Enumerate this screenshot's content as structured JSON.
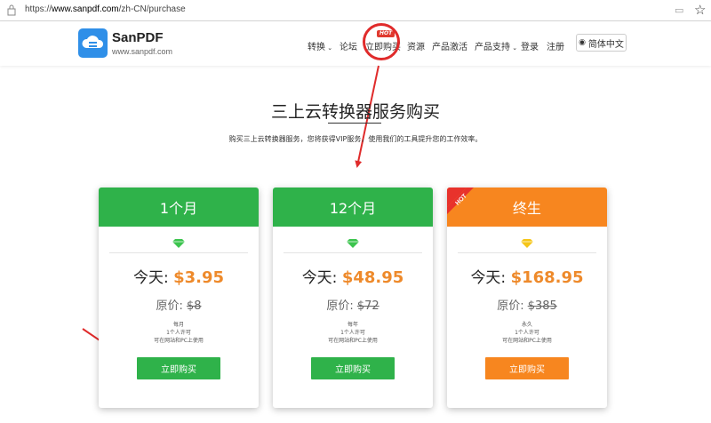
{
  "browser": {
    "url_prefix": "https://",
    "url_domain": "www.sanpdf.com",
    "url_path": "/zh-CN/purchase"
  },
  "header": {
    "logo_name": "SanPDF",
    "logo_url": "www.sanpdf.com",
    "nav": [
      {
        "label": "转换",
        "dropdown": true
      },
      {
        "label": "论坛"
      },
      {
        "label": "立即购买",
        "badge": "HOT"
      },
      {
        "label": "资源"
      },
      {
        "label": "产品激活"
      },
      {
        "label": "产品支持",
        "dropdown": true
      },
      {
        "label": "登录"
      },
      {
        "label": "注册"
      }
    ],
    "language": "简体中文"
  },
  "page": {
    "title": "三上云转换器服务购买",
    "subtitle": "购买三上云转换器服务，您将获得VIP服务，使用我们的工具提升您的工作效率。"
  },
  "plans": [
    {
      "name": "1个月",
      "price_label": "今天: ",
      "price": "$3.95",
      "orig_label": "原价: ",
      "orig_price": "$8",
      "features": [
        "每月",
        "1个人许可",
        "可在网站和PC上使用"
      ],
      "button": "立即购买",
      "color": "#2fb24a",
      "diamond": "#3cc44e"
    },
    {
      "name": "12个月",
      "price_label": "今天: ",
      "price": "$48.95",
      "orig_label": "原价: ",
      "orig_price": "$72",
      "features": [
        "每年",
        "1个人许可",
        "可在网站和PC上使用"
      ],
      "button": "立即购买",
      "color": "#2fb24a",
      "diamond": "#3cc44e"
    },
    {
      "name": "终生",
      "price_label": "今天: ",
      "price": "$168.95",
      "orig_label": "原价: ",
      "orig_price": "$385",
      "features": [
        "永久",
        "1个人许可",
        "可在网站和PC上使用"
      ],
      "button": "立即购买",
      "color": "#f7861f",
      "diamond": "#f5c518",
      "ribbon": "HOT"
    }
  ],
  "colors": {
    "accent_green": "#2fb24a",
    "accent_orange": "#f7861f",
    "price_orange": "#ee8a2b",
    "annotation_red": "#e02b2b"
  }
}
